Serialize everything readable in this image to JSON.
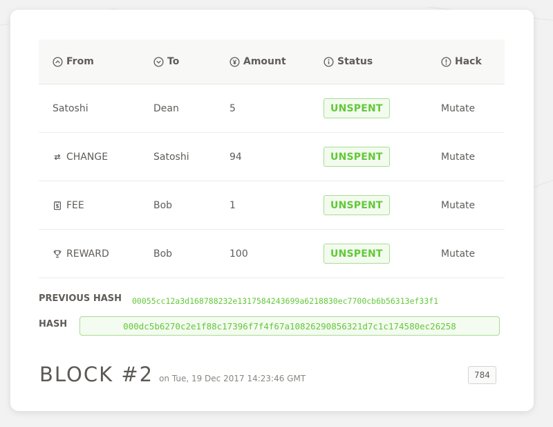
{
  "table": {
    "headers": {
      "from": "From",
      "to": "To",
      "amount": "Amount",
      "status": "Status",
      "hack": "Hack"
    },
    "rows": [
      {
        "from": "Satoshi",
        "from_icon": "",
        "to": "Dean",
        "amount": "5",
        "status": "UNSPENT",
        "hack": "Mutate"
      },
      {
        "from": "CHANGE",
        "from_icon": "swap-arrows-icon",
        "to": "Satoshi",
        "amount": "94",
        "status": "UNSPENT",
        "hack": "Mutate"
      },
      {
        "from": "FEE",
        "from_icon": "receipt-icon",
        "to": "Bob",
        "amount": "1",
        "status": "UNSPENT",
        "hack": "Mutate"
      },
      {
        "from": "REWARD",
        "from_icon": "trophy-icon",
        "to": "Bob",
        "amount": "100",
        "status": "UNSPENT",
        "hack": "Mutate"
      }
    ]
  },
  "hashes": {
    "previous_label": "PREVIOUS HASH",
    "previous_value": "00055cc12a3d168788232e1317584243699a6218830ec7700cb6b56313ef33f1",
    "current_label": "HASH",
    "current_value": "000dc5b6270c2e1f88c17396f7f4f67a10826290856321d7c1c174580ec26258"
  },
  "block": {
    "title": "BLOCK #2",
    "timestamp": "on Tue, 19 Dec 2017 14:23:46 GMT",
    "nonce": "784"
  },
  "colors": {
    "accent_green": "#62c83a",
    "badge_border": "#a9dc92",
    "text": "#5f5c58"
  }
}
